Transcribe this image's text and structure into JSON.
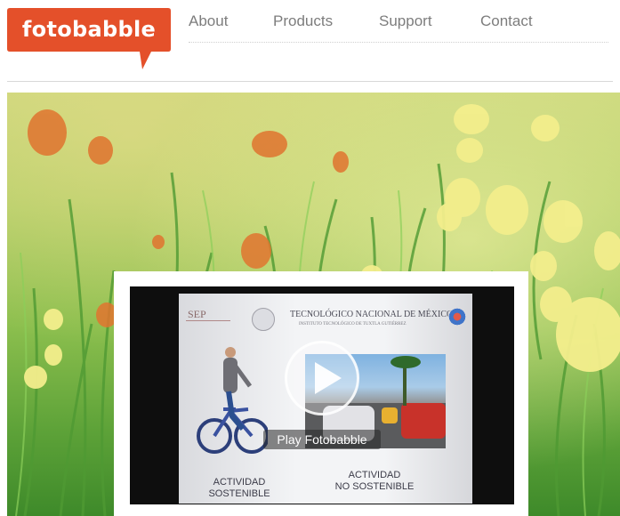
{
  "brand": {
    "name": "fotobabble",
    "color": "#e4502a"
  },
  "nav": {
    "items": [
      {
        "label": "About"
      },
      {
        "label": "Products"
      },
      {
        "label": "Support"
      },
      {
        "label": "Contact"
      }
    ]
  },
  "video": {
    "play_label": "Play Fotobabble",
    "slide": {
      "sep": "SEP",
      "title": "TECNOLÓGICO NACIONAL DE MÉXICO",
      "subtitle": "INSTITUTO TECNOLÓGICO DE TUXTLA GUTIÉRREZ",
      "left_caption_line1": "ACTIVIDAD",
      "left_caption_line2": "SOSTENIBLE",
      "right_caption_line1": "ACTIVIDAD",
      "right_caption_line2": "NO SOSTENIBLE"
    }
  }
}
